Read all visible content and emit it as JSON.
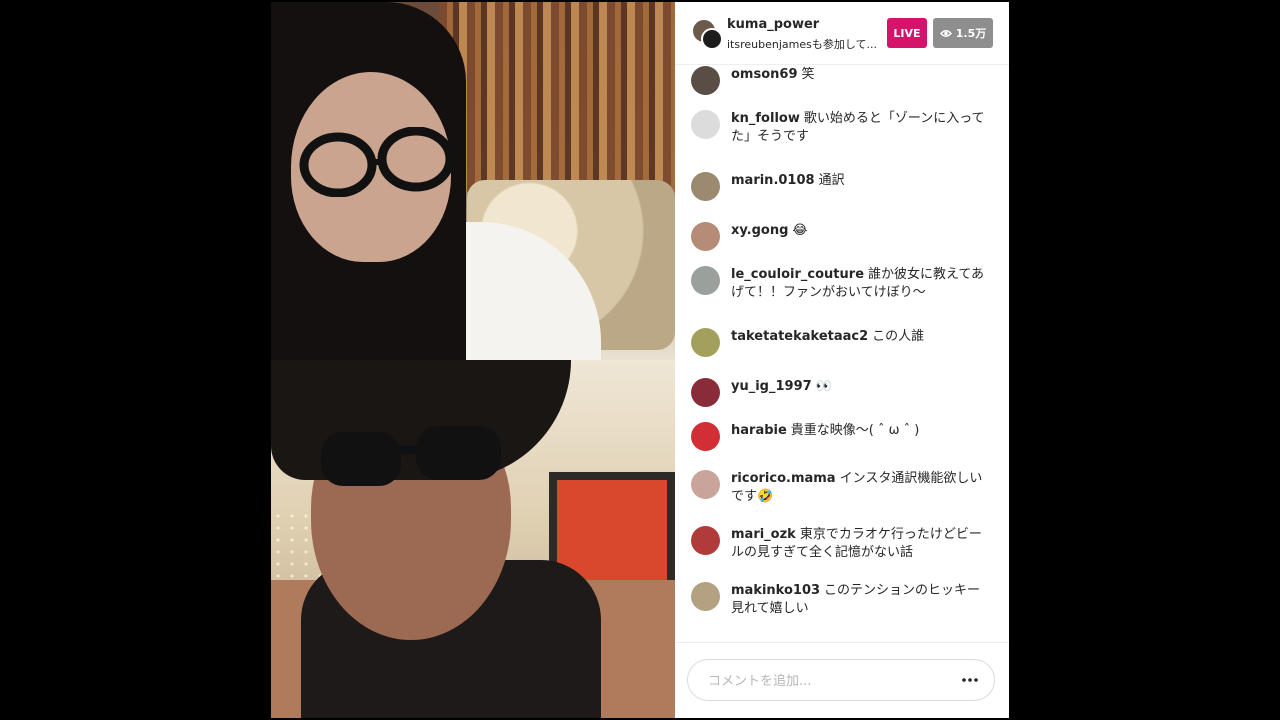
{
  "header": {
    "host_username": "kuma_power",
    "guest_text": "itsreubenjamesも参加して...",
    "live_label": "LIVE",
    "viewer_count": "1.5万"
  },
  "comments": [
    {
      "user": "omson69",
      "text": "笑",
      "avatar_color": "#5a4d45"
    },
    {
      "user": "kn_follow",
      "text": "歌い始めると「ゾーンに入ってた」そうです",
      "avatar_color": "#dcdcdc"
    },
    {
      "user": "marin.0108",
      "text": "通訳",
      "avatar_color": "#9b8a70"
    },
    {
      "user": "xy.gong",
      "text": "😂",
      "avatar_color": "#b48c77"
    },
    {
      "user": "le_couloir_couture",
      "text": "誰か彼女に教えてあげて！！ファンがおいてけぼり〜",
      "avatar_color": "#9aa09c"
    },
    {
      "user": "taketatekaketaac2",
      "text": "この人誰",
      "avatar_color": "#a3a05d"
    },
    {
      "user": "yu_ig_1997",
      "text": "👀",
      "avatar_color": "#8a2b3a"
    },
    {
      "user": "harabie",
      "text": "貴重な映像〜( ˆ ω ˆ )",
      "avatar_color": "#d12f35"
    },
    {
      "user": "ricorico.mama",
      "text": "インスタ通訳機能欲しいです🤣",
      "avatar_color": "#c9a49a"
    },
    {
      "user": "mari_ozk",
      "text": "東京でカラオケ行ったけどビールの見すぎて全く記憶がない話",
      "avatar_color": "#b13a3a"
    },
    {
      "user": "makinko103",
      "text": "このテンションのヒッキー見れて嬉しい",
      "avatar_color": "#b4a182"
    }
  ],
  "input": {
    "placeholder": "コメントを追加...",
    "more_label": "•••"
  },
  "colors": {
    "live_badge": "#d6136a",
    "viewer_badge": "#8e8e8e",
    "text": "#262626"
  }
}
